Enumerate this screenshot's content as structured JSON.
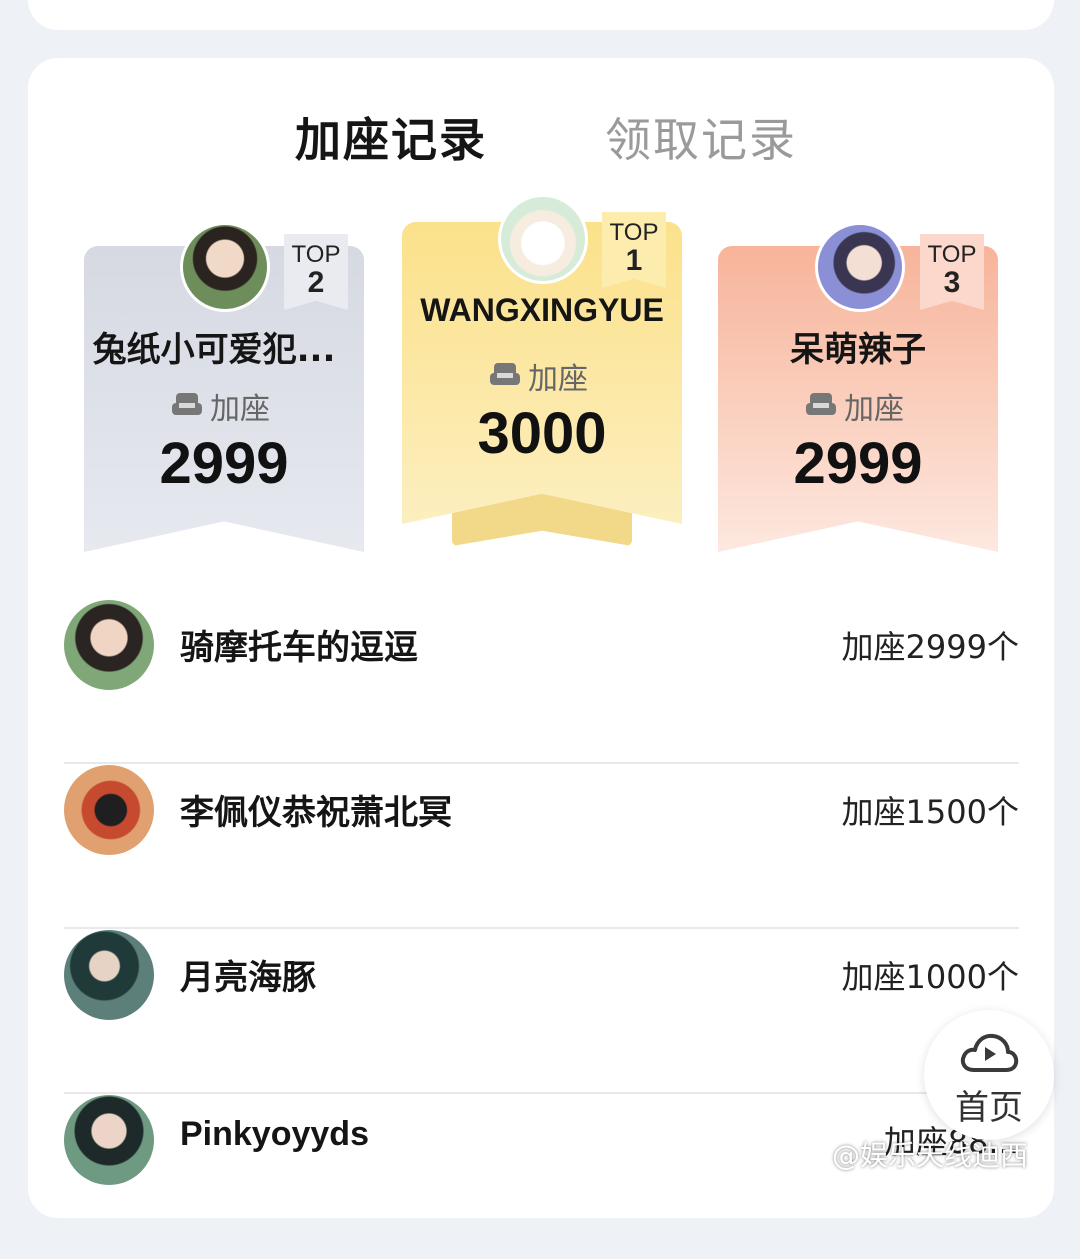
{
  "tabs": {
    "active": "加座记录",
    "inactive": "领取记录"
  },
  "podium": {
    "seat_label": "加座",
    "first": {
      "badge_top": "TOP",
      "rank": "1",
      "name": "WANGXINGYUE",
      "value": "3000"
    },
    "second": {
      "badge_top": "TOP",
      "rank": "2",
      "name": "兔纸小可爱犯...",
      "value": "2999"
    },
    "third": {
      "badge_top": "TOP",
      "rank": "3",
      "name": "呆萌辣子",
      "value": "2999"
    }
  },
  "list": [
    {
      "name": "骑摩托车的逗逗",
      "value": "加座2999个"
    },
    {
      "name": "李佩仪恭祝萧北冥",
      "value": "加座1500个"
    },
    {
      "name": "月亮海豚",
      "value": "加座1000个"
    },
    {
      "name": "Pinkyoyyds",
      "value": "加座88..."
    }
  ],
  "home_button": {
    "label": "首页",
    "icon": "cloud-play-icon"
  },
  "watermark": "@娱乐天线迪西"
}
